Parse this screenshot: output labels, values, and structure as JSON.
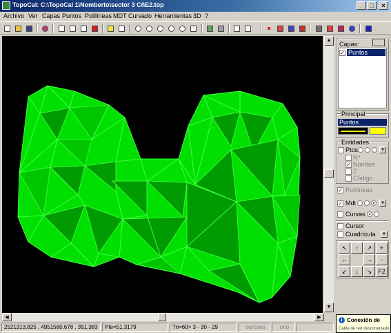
{
  "window": {
    "title": "TopoCal: C:\\TopoCal 1\\Nomberto\\sector 3 CñE2.top"
  },
  "menu": [
    "Archivo",
    "Ver",
    "Capas",
    "Puntos",
    "Polilíneas",
    "MDT",
    "Curvado",
    "Herramientas",
    "3D",
    "?"
  ],
  "panel": {
    "capas_title": "Capas:",
    "capas_item": "Puntos",
    "principal_title": "Principal",
    "principal_layer": "Puntos",
    "entidades_title": "Entidades",
    "ptos": "Ptos",
    "n": "Nº",
    "nombre": "Nombre",
    "z": "Z",
    "codigo": "Código",
    "polilineas": "Polilíneas",
    "mdt": "Mdt",
    "curvas": "Curvas",
    "cursor": "Cursor",
    "cuadricula": "Cuadrícula",
    "nav": [
      "↖",
      "↑",
      "↗",
      "+",
      "←",
      "",
      "→",
      "-",
      "↙",
      "↓",
      "↘",
      "F2"
    ]
  },
  "status": {
    "coords": "2521313,825 , 4951580,678 , 351,383",
    "pte": "Pte=51,3179",
    "tri": "Tri=60> 3 - 30 - 29",
    "cercano": "cercano",
    "orto": "orto"
  },
  "toast": {
    "title": "Conexión de",
    "body": "Cable de red desconectado"
  },
  "colors": {
    "mesh_fill": "#00e000",
    "mesh_line": "#3fff3f",
    "title_bar": "#0a246a",
    "selection": "#0a246a",
    "swatch_yellow": "#ffff00"
  }
}
